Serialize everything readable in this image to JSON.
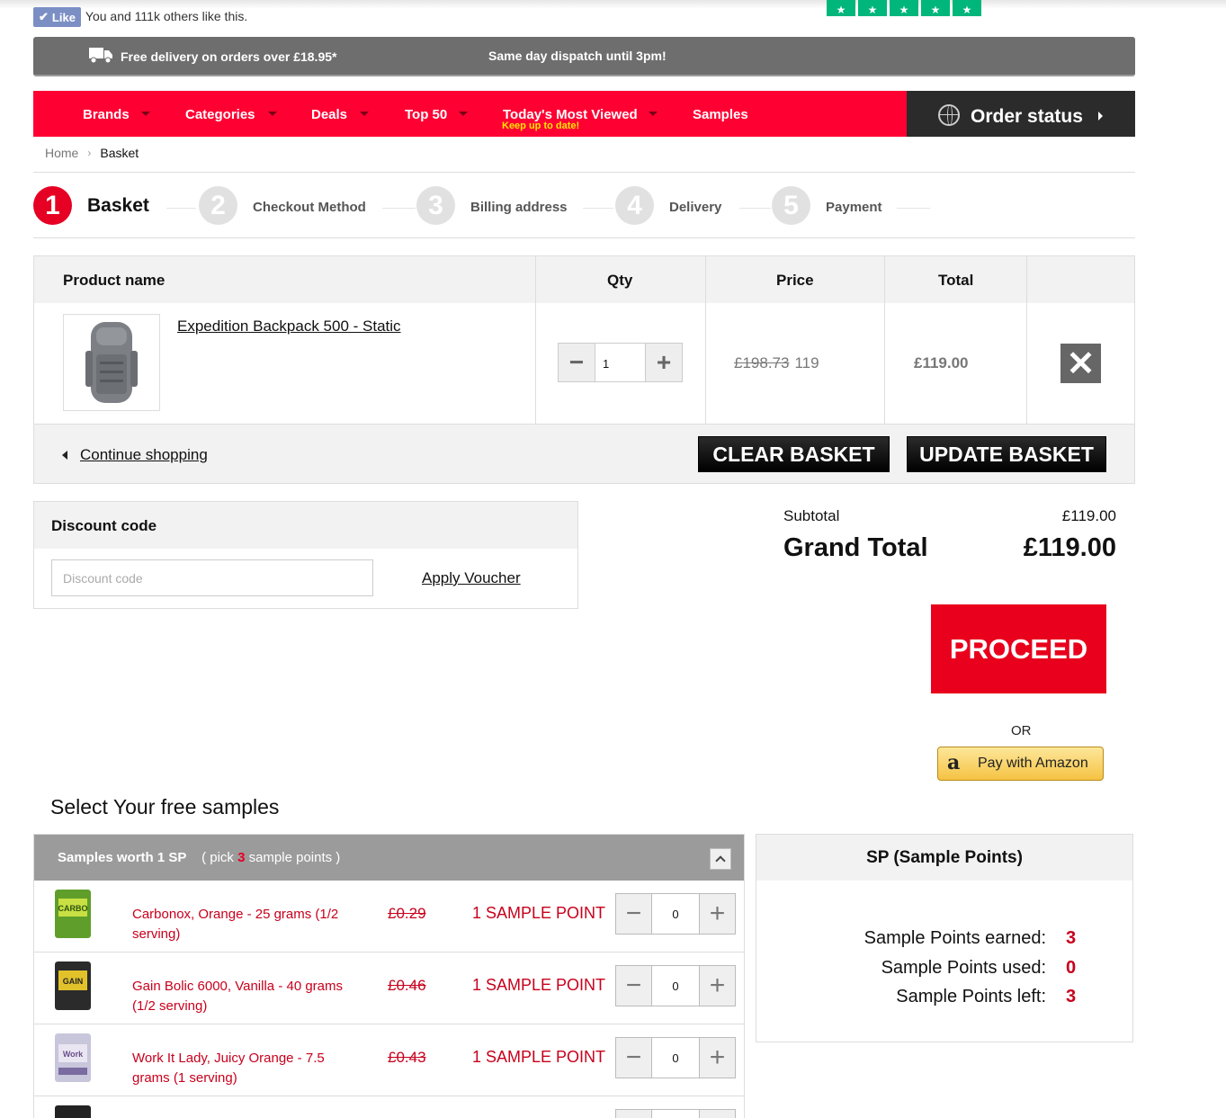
{
  "social": {
    "like_label": "Like",
    "like_text": "You and 111k others like this."
  },
  "delivery": {
    "free_text": "Free delivery on orders over £18.95*",
    "dispatch_text": "Same day dispatch until 3pm!"
  },
  "nav": {
    "items": [
      "Brands",
      "Categories",
      "Deals",
      "Top 50",
      "Today's Most Viewed",
      "Samples"
    ],
    "sub_label": "Keep up to date!",
    "order_status": "Order status"
  },
  "breadcrumb": {
    "home": "Home",
    "current": "Basket"
  },
  "steps": [
    {
      "num": "1",
      "label": "Basket"
    },
    {
      "num": "2",
      "label": "Checkout Method"
    },
    {
      "num": "3",
      "label": "Billing address"
    },
    {
      "num": "4",
      "label": "Delivery"
    },
    {
      "num": "5",
      "label": "Payment"
    }
  ],
  "basket": {
    "headers": {
      "product": "Product name",
      "qty": "Qty",
      "price": "Price",
      "total": "Total"
    },
    "item": {
      "name": "Expedition Backpack 500 - Static",
      "qty": "1",
      "old_price": "£198.73",
      "price": "119",
      "total": "£119.00"
    },
    "continue": "Continue shopping",
    "clear": "CLEAR BASKET",
    "update": "UPDATE BASKET"
  },
  "discount": {
    "title": "Discount code",
    "placeholder": "Discount code",
    "apply": "Apply Voucher"
  },
  "totals": {
    "subtotal_label": "Subtotal",
    "subtotal": "£119.00",
    "grand_label": "Grand Total",
    "grand": "£119.00"
  },
  "checkout": {
    "proceed": "PROCEED",
    "or": "OR",
    "amazon": "Pay with Amazon"
  },
  "samples": {
    "title": "Select Your free samples",
    "group_label": "Samples worth 1 SP",
    "pick_prefix": "( pick",
    "pick_count": "3",
    "pick_suffix": "sample points )",
    "items": [
      {
        "name": "Carbonox, Orange - 25 grams (1/2 serving)",
        "old_price": "£0.29",
        "points": "1 SAMPLE POINT",
        "qty": "0"
      },
      {
        "name": "Gain Bolic 6000, Vanilla - 40 grams (1/2 serving)",
        "old_price": "£0.46",
        "points": "1 SAMPLE POINT",
        "qty": "0"
      },
      {
        "name": "Work It Lady, Juicy Orange - 7.5 grams (1 serving)",
        "old_price": "£0.43",
        "points": "1 SAMPLE POINT",
        "qty": "0"
      }
    ]
  },
  "sample_points": {
    "title": "SP (Sample Points)",
    "earned_label": "Sample Points earned:",
    "earned": "3",
    "used_label": "Sample Points used:",
    "used": "0",
    "left_label": "Sample Points left:",
    "left": "3"
  }
}
